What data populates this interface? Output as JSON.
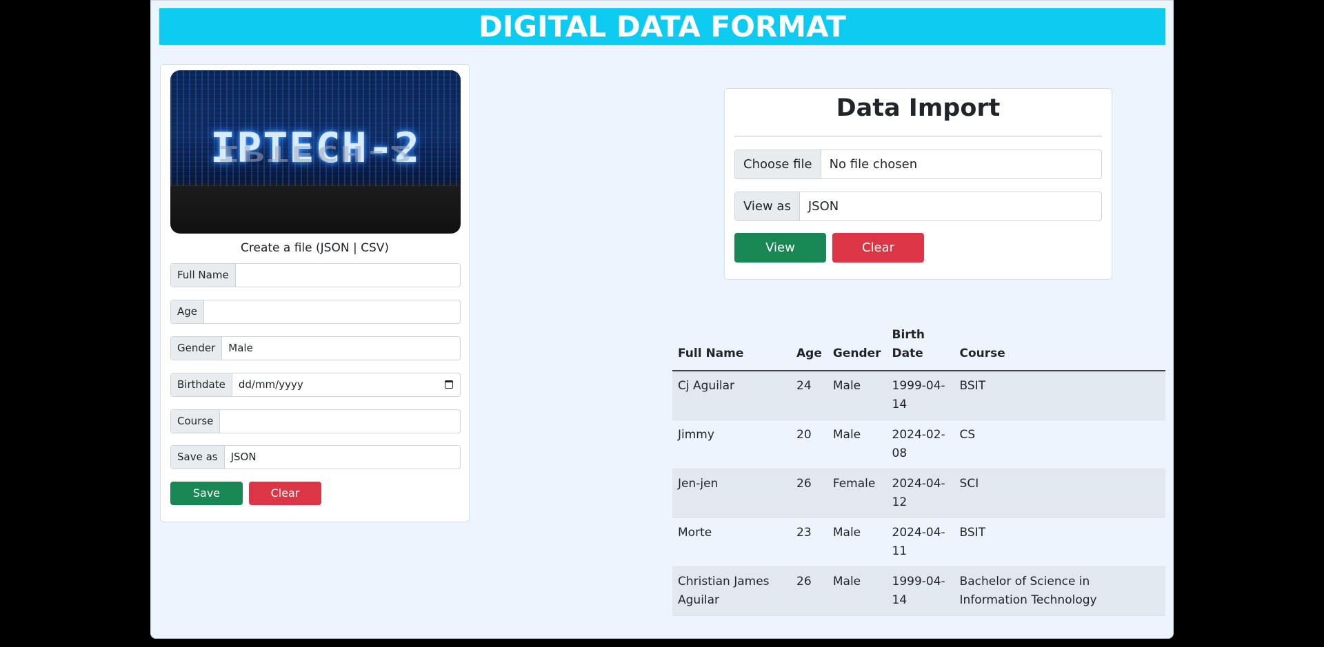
{
  "banner": {
    "title": "DIGITAL DATA FORMAT"
  },
  "create_form": {
    "hero_text": "IPTECH-2",
    "caption": "Create a file (JSON | CSV)",
    "full_name": {
      "label": "Full Name",
      "value": ""
    },
    "age": {
      "label": "Age",
      "value": ""
    },
    "gender": {
      "label": "Gender",
      "value": "Male"
    },
    "birthdate": {
      "label": "Birthdate",
      "value": "dd/mm/yyyy"
    },
    "course": {
      "label": "Course",
      "value": ""
    },
    "save_as": {
      "label": "Save as",
      "value": "JSON"
    },
    "save_button": "Save",
    "clear_button": "Clear"
  },
  "import": {
    "title": "Data Import",
    "choose_file_label": "Choose file",
    "file_status": "No file chosen",
    "view_as_label": "View as",
    "view_as_value": "JSON",
    "view_button": "View",
    "clear_button": "Clear"
  },
  "table": {
    "headers": [
      "Full Name",
      "Age",
      "Gender",
      "Birth Date",
      "Course"
    ],
    "rows": [
      [
        "Cj Aguilar",
        "24",
        "Male",
        "1999-04-14",
        "BSIT"
      ],
      [
        "Jimmy",
        "20",
        "Male",
        "2024-02-08",
        "CS"
      ],
      [
        "Jen-jen",
        "26",
        "Female",
        "2024-04-12",
        "SCI"
      ],
      [
        "Morte",
        "23",
        "Male",
        "2024-04-11",
        "BSIT"
      ],
      [
        "Christian James Aguilar",
        "26",
        "Male",
        "1999-04-14",
        "Bachelor of Science in Information Technology"
      ]
    ]
  },
  "colors": {
    "banner": "#0dcaf0",
    "primary_action": "#198754",
    "danger_action": "#dc3545",
    "page_background": "#ecf5fd"
  }
}
